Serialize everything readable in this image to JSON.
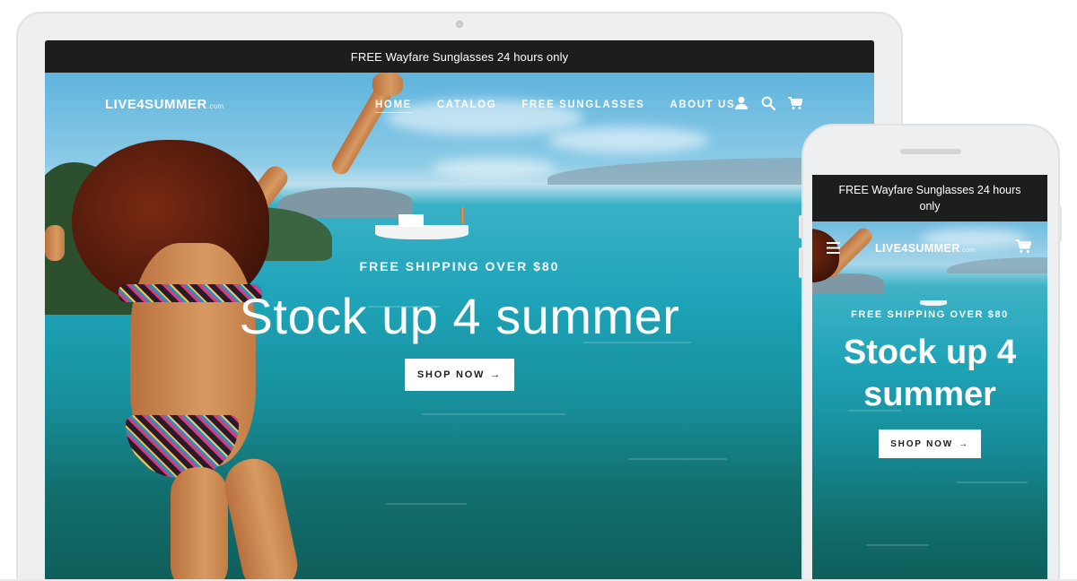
{
  "desktop": {
    "announcement": "FREE Wayfare Sunglasses 24 hours only",
    "logo": {
      "name": "LIVE4SUMMER",
      "suffix": ".com"
    },
    "nav": [
      {
        "label": "HOME"
      },
      {
        "label": "CATALOG"
      },
      {
        "label": "FREE SUNGLASSES"
      },
      {
        "label": "ABOUT US"
      }
    ],
    "icons": [
      "account-icon",
      "search-icon",
      "cart-icon"
    ],
    "hero": {
      "caption": "FREE SHIPPING OVER $80",
      "heading": "Stock up 4 summer",
      "button": "SHOP NOW",
      "button_arrow": "→"
    }
  },
  "mobile": {
    "announcement": "FREE Wayfare Sunglasses 24 hours only",
    "logo": {
      "name": "LIVE4SUMMER",
      "suffix": ".com"
    },
    "icons": [
      "menu-icon",
      "cart-icon"
    ],
    "hero": {
      "caption": "FREE SHIPPING OVER $80",
      "heading": "Stock up 4 summer",
      "button": "SHOP NOW",
      "button_arrow": "→"
    }
  },
  "colors": {
    "announcement_bg": "#1c1d1d",
    "text_on_hero": "#ffffff",
    "button_bg": "#ffffff",
    "button_text": "#1c1d1d",
    "device_frame": "#eeeff0"
  }
}
